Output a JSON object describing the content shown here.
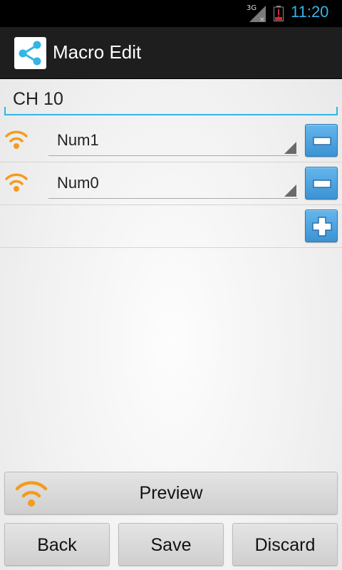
{
  "status_bar": {
    "network": "3G",
    "time": "11:20"
  },
  "action_bar": {
    "title": "Macro Edit",
    "icon": "share-icon"
  },
  "macro": {
    "name": "CH 10"
  },
  "steps": [
    {
      "label": "Num1",
      "icon": "wifi-signal-icon",
      "action": "remove"
    },
    {
      "label": "Num0",
      "icon": "wifi-signal-icon",
      "action": "remove"
    }
  ],
  "add_step": {
    "icon": "plus-icon"
  },
  "buttons": {
    "preview": "Preview",
    "back": "Back",
    "save": "Save",
    "discard": "Discard"
  },
  "colors": {
    "accent": "#33b5e5",
    "button_blue": "#4aa3df",
    "signal_orange": "#f39c1e",
    "action_bar": "#1e1e1e"
  }
}
